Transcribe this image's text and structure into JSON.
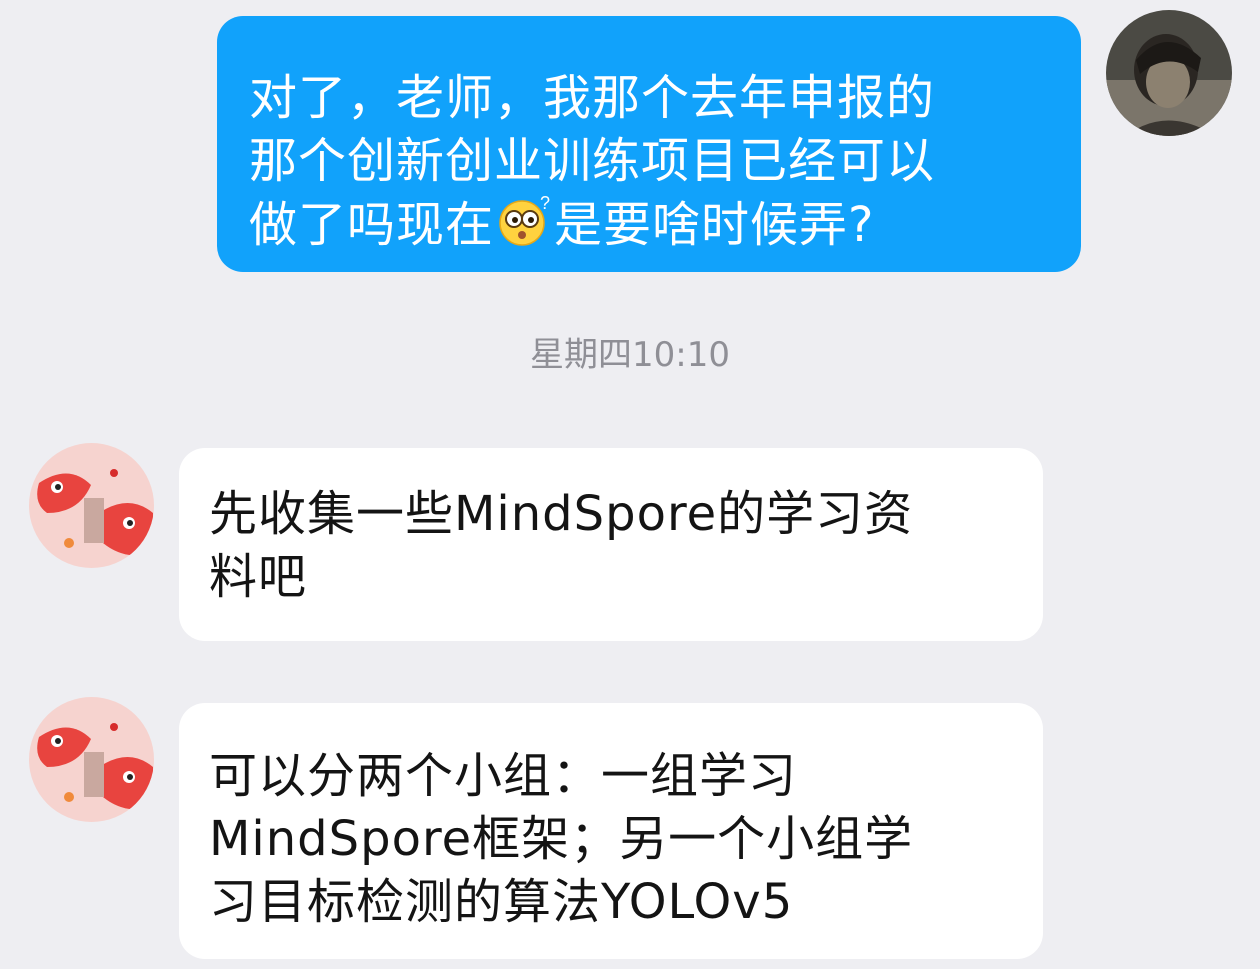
{
  "chat": {
    "timestamp": "星期四10:10",
    "outgoing": {
      "line1": "对了，老师，我那个去年申报的",
      "line2": "那个创新创业训练项目已经可以",
      "line3_before": "做了吗现在",
      "line3_emoji": "thinking-face-emoji",
      "line3_after": "是要啥时候弄?"
    },
    "incoming": [
      {
        "line1": "先收集一些MindSpore的学习资",
        "line2": "料吧"
      },
      {
        "line1": "可以分两个小组：一组学习",
        "line2": "MindSpore框架；另一个小组学",
        "line3": "习目标检测的算法YOLOv5"
      }
    ]
  },
  "colors": {
    "background": "#eeeef2",
    "outgoing_bubble": "#11a2fb",
    "incoming_bubble": "#ffffff",
    "timestamp_text": "#8f8f96"
  }
}
